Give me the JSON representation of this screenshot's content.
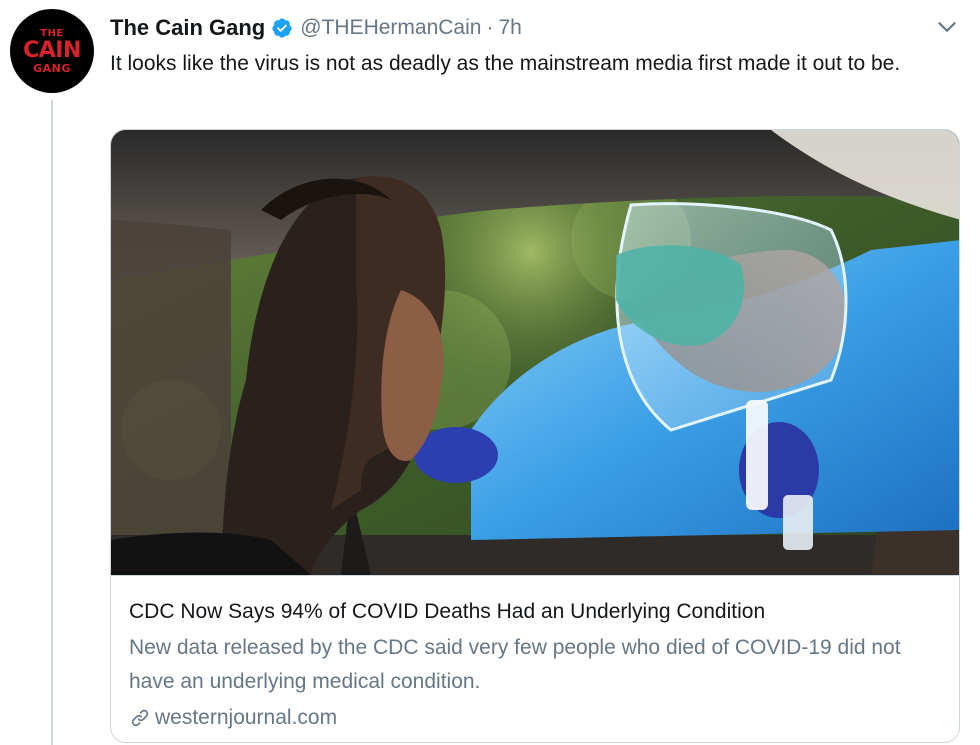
{
  "author": {
    "avatar_text": {
      "line1": "THE",
      "line2": "CAIN",
      "line3": "GANG"
    },
    "name": "The Cain Gang",
    "handle": "@THEHermanCain",
    "separator": "·",
    "time": "7h"
  },
  "tweet": {
    "text": "It looks like the virus is not as deadly as the mainstream media first made it out to be."
  },
  "card": {
    "title": "CDC Now Says 94% of COVID Deaths Had an Underlying Condition",
    "description": "New data released by the CDC said very few people who died of COVID-19 did not have an underlying medical condition.",
    "domain": "westernjournal.com",
    "image_subject": "drive-through-covid-test-photo"
  },
  "icons": {
    "verified": "verified-badge-icon",
    "caret": "chevron-down-icon",
    "link": "link-icon"
  },
  "colors": {
    "verified_blue": "#1da1f2",
    "secondary_text": "#657786",
    "border": "#ccd6dd",
    "avatar_red": "#d8232a"
  }
}
